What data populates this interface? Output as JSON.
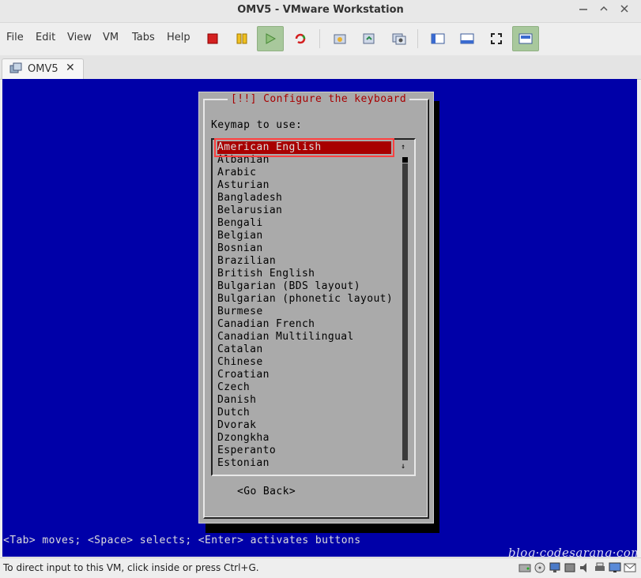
{
  "window": {
    "title": "OMV5 - VMware Workstation",
    "controls": [
      "minimize",
      "maximize",
      "close"
    ]
  },
  "menu": [
    "File",
    "Edit",
    "View",
    "VM",
    "Tabs",
    "Help"
  ],
  "toolbar": {
    "buttons": [
      "power-off-icon",
      "suspend-icon",
      "power-on-icon",
      "reset-icon",
      "snapshot-icon",
      "revert-snapshot-icon",
      "snapshot-manager-icon",
      "library-icon",
      "thumbnail-bar-icon",
      "full-screen-icon",
      "console-view-icon"
    ]
  },
  "tabs": [
    {
      "label": "OMV5",
      "close": "✕"
    }
  ],
  "installer": {
    "dialog_title": "[!!] Configure the keyboard",
    "prompt": "Keymap to use:",
    "keymaps": [
      "American English",
      "Albanian",
      "Arabic",
      "Asturian",
      "Bangladesh",
      "Belarusian",
      "Bengali",
      "Belgian",
      "Bosnian",
      "Brazilian",
      "British English",
      "Bulgarian (BDS layout)",
      "Bulgarian (phonetic layout)",
      "Burmese",
      "Canadian French",
      "Canadian Multilingual",
      "Catalan",
      "Chinese",
      "Croatian",
      "Czech",
      "Danish",
      "Dutch",
      "Dvorak",
      "Dzongkha",
      "Esperanto",
      "Estonian"
    ],
    "selected_index": 0,
    "go_back": "<Go Back>",
    "hint": "<Tab> moves; <Space> selects; <Enter> activates buttons",
    "scroll_up": "↑",
    "scroll_down": "↓"
  },
  "watermark": "blog·codesarang·com",
  "status": {
    "message": "To direct input to this VM, click inside or press Ctrl+G.",
    "icons": [
      "hard-disk-icon",
      "cd-rom-icon",
      "network-icon",
      "usb-icon",
      "sound-icon",
      "printer-icon",
      "display-icon",
      "message-icon"
    ]
  },
  "colors": {
    "vm_background": "#0000a8",
    "dialog_background": "#aaaaaa",
    "title_text": "#a80000",
    "selection": "#a80000"
  }
}
